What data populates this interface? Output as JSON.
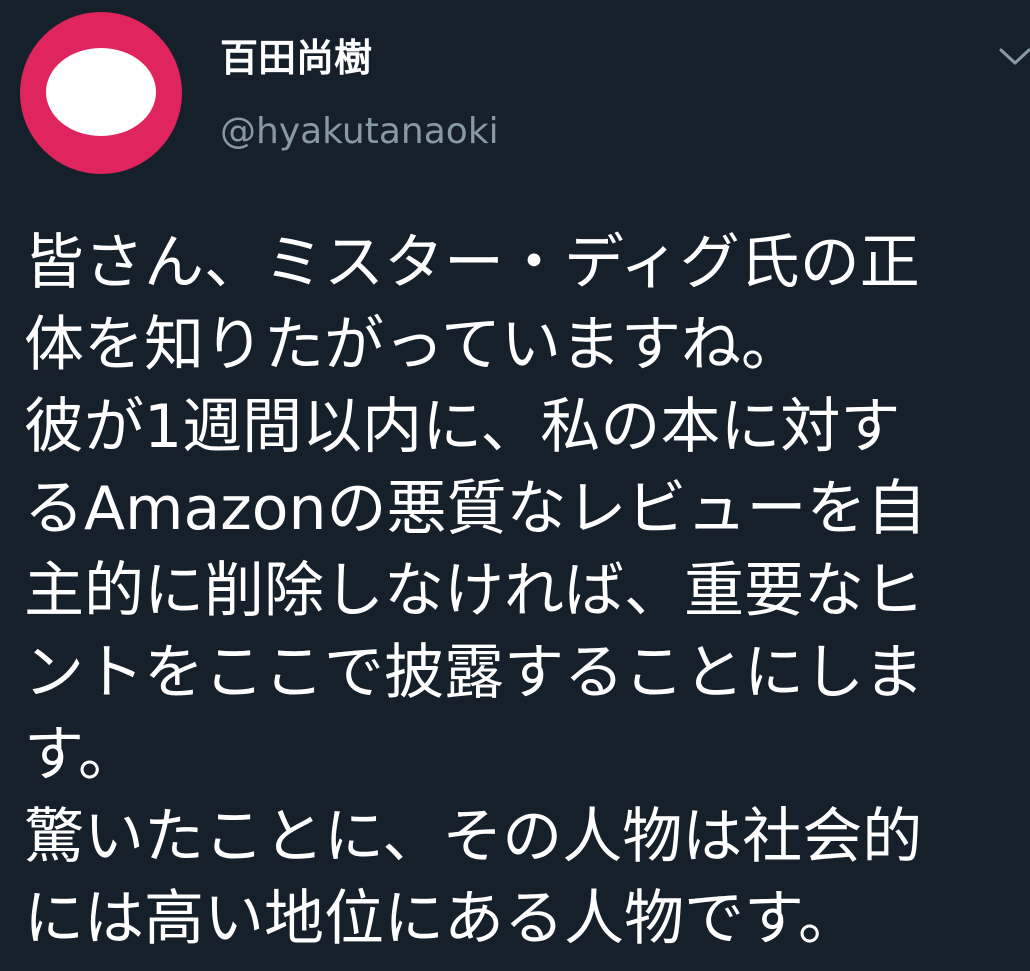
{
  "author": {
    "display_name": "百田尚樹",
    "handle": "@hyakutanaoki",
    "avatar_colors": {
      "ring": "#e0245e",
      "center": "#ffffff"
    }
  },
  "menu": {
    "icon": "chevron-down-icon"
  },
  "tweet": {
    "lines": [
      "皆さん、ミスター・ディグ氏の正",
      "体を知りたがっていますね。",
      "彼が1週間以内に、私の本に対す",
      "るAmazonの悪質なレビューを自",
      "主的に削除しなければ、重要なヒ",
      "ントをここで披露することにしま",
      "す。",
      "驚いたことに、その人物は社会的",
      "には高い地位にある人物です。"
    ]
  },
  "theme": {
    "background": "#15202b",
    "primary_text": "#ffffff",
    "secondary_text": "#8899a6"
  }
}
